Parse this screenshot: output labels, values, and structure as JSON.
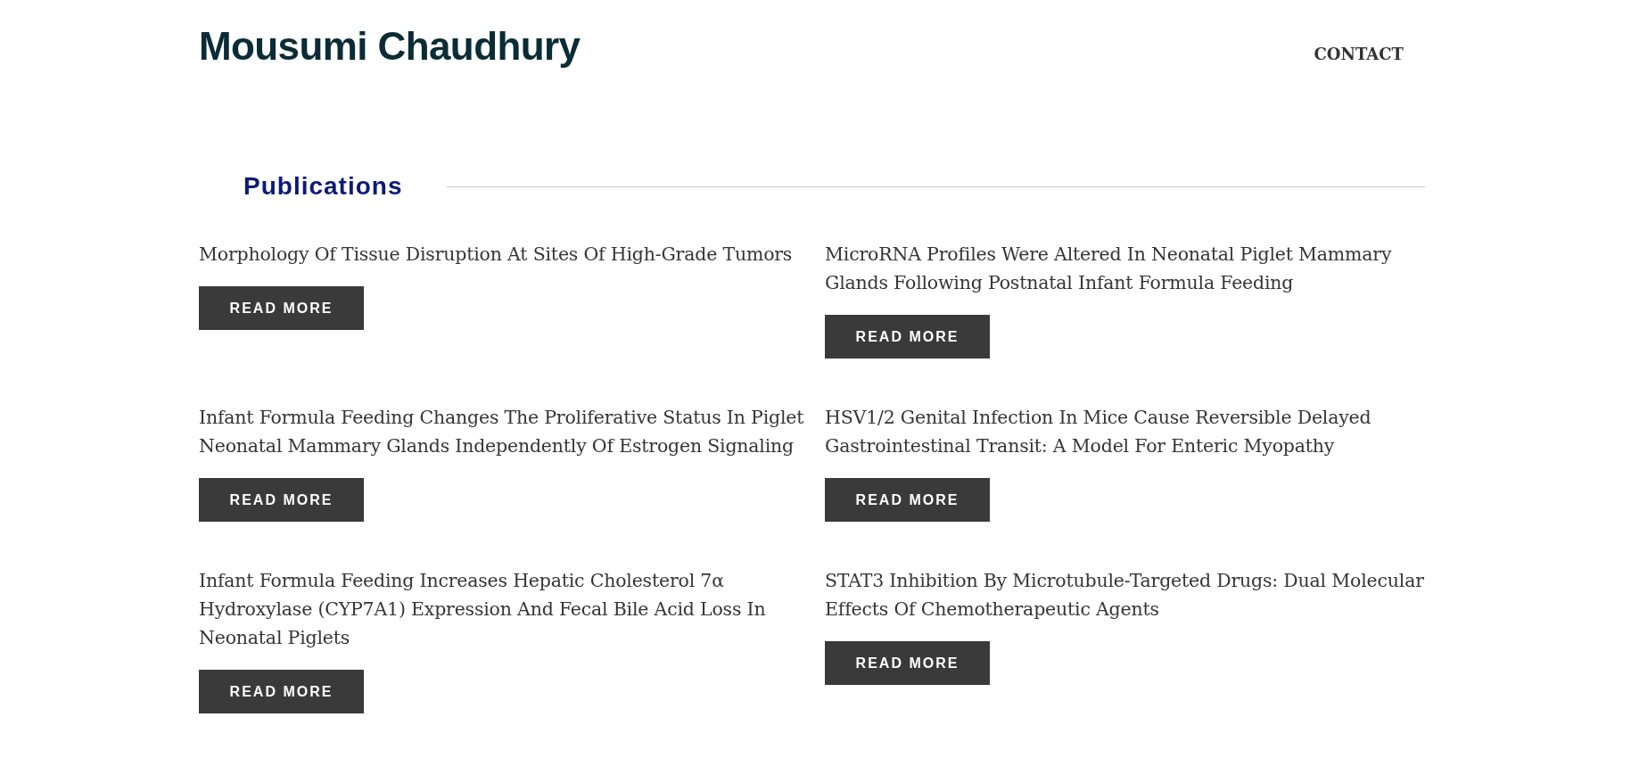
{
  "header": {
    "logo": "Mousumi Chaudhury",
    "nav": [
      {
        "label": "CONTACT"
      }
    ]
  },
  "section": {
    "title": "Publications"
  },
  "publications": [
    {
      "title": "Morphology Of Tissue Disruption At Sites Of High-Grade Tumors",
      "button": "READ MORE"
    },
    {
      "title": "MicroRNA Profiles Were Altered In Neonatal Piglet Mammary Glands Following Postnatal Infant Formula Feeding",
      "button": "READ MORE"
    },
    {
      "title": "Infant Formula Feeding Changes The Proliferative Status In Piglet Neonatal Mammary Glands Independently Of Estrogen Signaling",
      "button": "READ MORE"
    },
    {
      "title": "HSV1/2 Genital Infection In Mice Cause Reversible Delayed Gastrointestinal Transit: A Model For Enteric Myopathy",
      "button": "READ MORE"
    },
    {
      "title": "Infant Formula Feeding Increases Hepatic Cholesterol 7α Hydroxylase (CYP7A1) Expression And Fecal Bile Acid Loss In Neonatal Piglets",
      "button": "READ MORE"
    },
    {
      "title": "STAT3 Inhibition By Microtubule-Targeted Drugs: Dual Molecular Effects Of Chemotherapeutic Agents",
      "button": "READ MORE"
    }
  ]
}
